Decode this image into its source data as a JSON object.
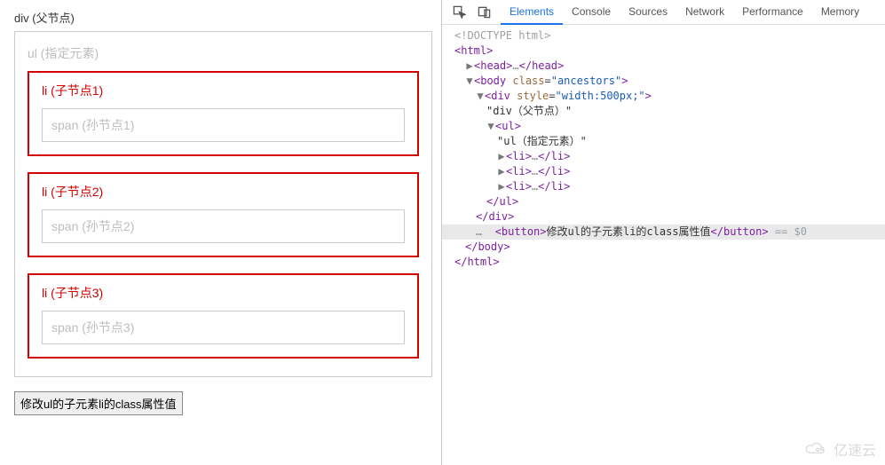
{
  "page": {
    "div_label": "div (父节点)",
    "ul_label": "ul (指定元素)",
    "li_labels": [
      "li (子节点1)",
      "li (子节点2)",
      "li (子节点3)"
    ],
    "span_labels": [
      "span (孙节点1)",
      "span (孙节点2)",
      "span (孙节点3)"
    ],
    "button_label": "修改ul的子元素li的class属性值"
  },
  "devtools": {
    "tabs": [
      "Elements",
      "Console",
      "Sources",
      "Network",
      "Performance",
      "Memory"
    ],
    "active_tab_index": 0,
    "dom": {
      "doctype": "<!DOCTYPE html>",
      "html_open": "<html>",
      "head_open": "<head>",
      "head_ell": "…",
      "head_close": "</head>",
      "body_open_tag": "body",
      "body_class_name": "class",
      "body_class_val": "\"ancestors\"",
      "div_open_tag": "div",
      "div_style_name": "style",
      "div_style_val": "\"width:500px;\"",
      "div_text": "\"div（父节点）\"",
      "ul_open": "<ul>",
      "ul_text": "\"ul（指定元素）\"",
      "li_open": "<li>",
      "li_ell": "…",
      "li_close": "</li>",
      "ul_close": "</ul>",
      "div_close": "</div>",
      "button_open": "<button>",
      "button_text": "修改ul的子元素li的class属性值",
      "button_close": "</button>",
      "eq0": " == $0",
      "body_close": "</body>",
      "html_close": "</html>"
    }
  },
  "watermark": "亿速云"
}
